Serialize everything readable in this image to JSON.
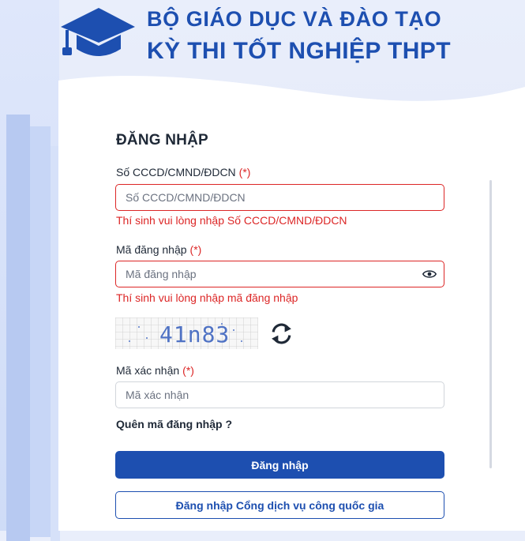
{
  "header": {
    "line1": "BỘ GIÁO DỤC VÀ ĐÀO TẠO",
    "line2": "KỲ THI TỐT NGHIỆP THPT"
  },
  "form": {
    "title": "ĐĂNG NHẬP",
    "required_mark": "(*)",
    "id_field": {
      "label": "Số CCCD/CMND/ĐDCN",
      "placeholder": "Số CCCD/CMND/ĐDCN",
      "value": "",
      "error": "Thí sinh vui lòng nhập Số CCCD/CMND/ĐDCN"
    },
    "code_field": {
      "label": "Mã đăng nhập",
      "placeholder": "Mã đăng nhập",
      "value": "",
      "error": "Thí sinh vui lòng nhập mã đăng nhập"
    },
    "captcha": {
      "text": "41n83"
    },
    "verify_field": {
      "label": "Mã xác nhận",
      "placeholder": "Mã xác nhận",
      "value": ""
    },
    "forgot_link": "Quên mã đăng nhập ?",
    "login_button": "Đăng nhập",
    "national_portal_button": "Đăng nhập Cổng dịch vụ công quốc gia"
  },
  "colors": {
    "brand": "#1d4fb0",
    "error": "#dc2626"
  }
}
